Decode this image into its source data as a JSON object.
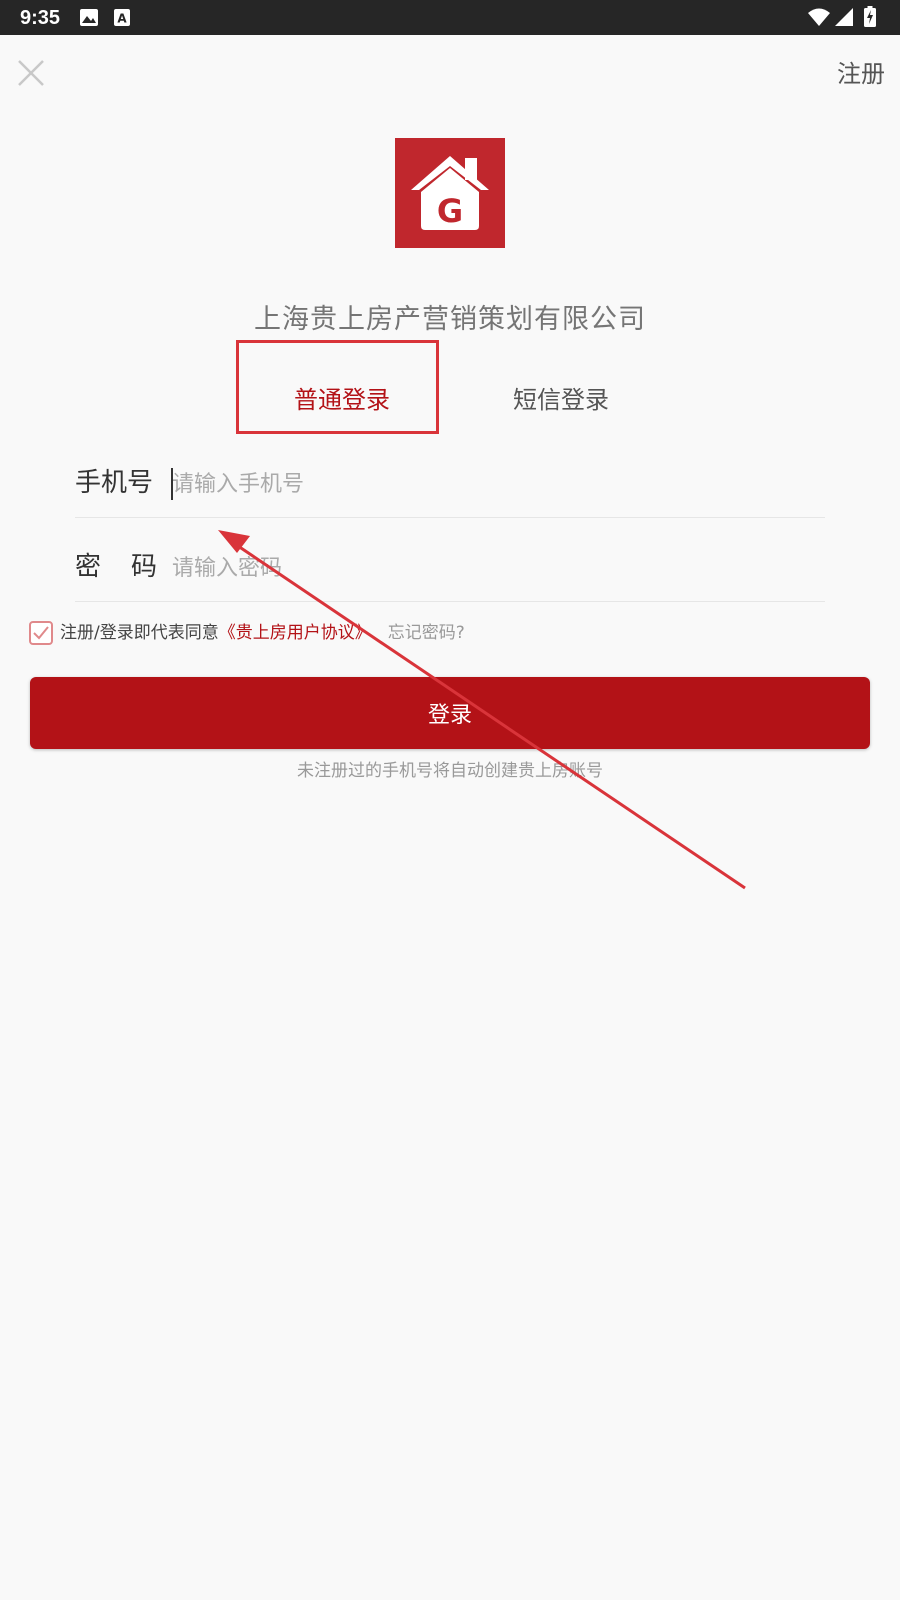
{
  "status_bar": {
    "time": "9:35",
    "icons": [
      "image-icon",
      "a-notification-icon",
      "wifi-icon",
      "cellular-signal-icon",
      "battery-charging-icon"
    ]
  },
  "header": {
    "close_icon": "close-icon",
    "register_label": "注册"
  },
  "brand": {
    "logo_letter": "G",
    "logo_color": "#c0272d",
    "company_name": "上海贵上房产营销策划有限公司"
  },
  "tabs": [
    {
      "label": "普通登录",
      "active": true
    },
    {
      "label": "短信登录",
      "active": false
    }
  ],
  "form": {
    "phone_label": "手机号",
    "phone_placeholder": "请输入手机号",
    "phone_value": "",
    "password_label": "密码",
    "password_placeholder": "请输入密码",
    "password_value": ""
  },
  "agreement": {
    "checked": true,
    "prefix": "注册/登录即代表同意",
    "link_text": "《贵上房用户协议》",
    "forgot_label": "忘记密码?"
  },
  "login_button_label": "登录",
  "hint": "未注册过的手机号将自动创建贵上房账号",
  "colors": {
    "accent": "#b31217",
    "status_bar": "#262626",
    "annotation": "#d9343a"
  }
}
